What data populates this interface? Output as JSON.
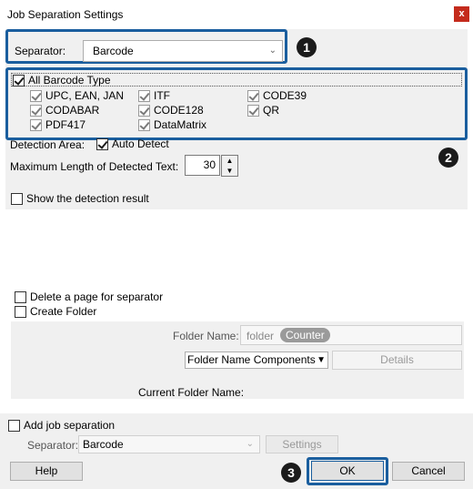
{
  "window": {
    "title": "Job Separation Settings",
    "close_glyph": "x"
  },
  "separator_top": {
    "label": "Separator:",
    "value": "Barcode"
  },
  "barcode": {
    "all_label": "All Barcode Type",
    "types": [
      {
        "label": "UPC, EAN, JAN",
        "checked": true
      },
      {
        "label": "ITF",
        "checked": true
      },
      {
        "label": "CODE39",
        "checked": true
      },
      {
        "label": "CODABAR",
        "checked": true
      },
      {
        "label": "CODE128",
        "checked": true
      },
      {
        "label": "QR",
        "checked": true
      },
      {
        "label": "PDF417",
        "checked": true
      },
      {
        "label": "DataMatrix",
        "checked": true
      }
    ]
  },
  "detection": {
    "area_label": "Detection Area:",
    "auto_detect_label": "Auto Detect",
    "max_len_label": "Maximum Length of Detected Text:",
    "max_len_value": "30",
    "show_result_label": "Show the detection result"
  },
  "options": {
    "delete_page_label": "Delete a page for separator",
    "create_folder_label": "Create Folder",
    "folder_name_label": "Folder Name:",
    "folder_name_value": "folder",
    "folder_token": "Counter",
    "components_label": "Folder Name Components",
    "details_label": "Details",
    "current_folder_label": "Current Folder Name:"
  },
  "job": {
    "add_label": "Add job separation",
    "separator_label": "Separator:",
    "separator_value": "Barcode",
    "settings_label": "Settings"
  },
  "footer": {
    "help": "Help",
    "ok": "OK",
    "cancel": "Cancel"
  },
  "badges": {
    "b1": "1",
    "b2": "2",
    "b3": "3"
  },
  "colors": {
    "highlight": "#1a5e9e",
    "close": "#c42b1c",
    "panel": "#f0f0f0"
  }
}
